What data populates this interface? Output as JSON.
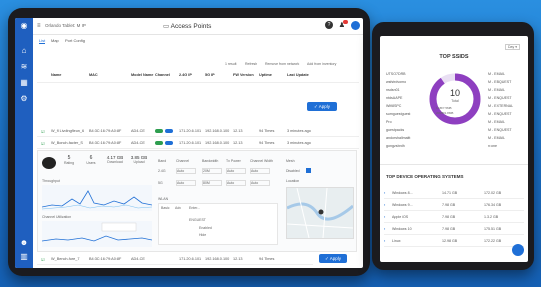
{
  "left": {
    "breadcrumb": "Orlando Tablet: M IP",
    "page_title": "Access Points",
    "tabs": [
      "List",
      "Map",
      "Port Config"
    ],
    "toolbar_actions": [
      "1 result",
      "Refresh",
      "Remove from network",
      "Add from inventory"
    ],
    "columns": [
      "Name",
      "MAC",
      "Model Name",
      "Channel",
      "2.4G IP",
      "5G IP",
      "FW Version",
      "Uptime",
      "Last Update"
    ],
    "apply_label": "Apply",
    "rows": [
      {
        "name": "W_fl Livdingfleun_6",
        "mac": "B4:3C:16:79:A0:8F",
        "model": "AD4-CE",
        "ip24": "171.20.6.101",
        "ip5": "192.168.0.100",
        "fw": "12.13",
        "uptime": "94 Times",
        "updated": "3 minutes ago"
      },
      {
        "name": "W_Bonch-facter_S",
        "mac": "B4:3C:16:79:A0:8F",
        "model": "AD4-CE",
        "ip24": "171.20.6.101",
        "ip5": "192.168.0.100",
        "fw": "12.13",
        "uptime": "94 Times",
        "updated": "3 minutes ago"
      },
      {
        "name": "W_Bench-fure_7",
        "mac": "B4:3C:16:79:A0:8F",
        "model": "AD4-CE",
        "ip24": "171.20.6.101",
        "ip5": "192.168.0.100",
        "fw": "12.13",
        "uptime": "94 Times",
        "updated": "3 minutes ago"
      }
    ],
    "detail": {
      "stats": [
        {
          "v": "5",
          "l": "Rating"
        },
        {
          "v": "6",
          "l": "Users"
        },
        {
          "v": "4.17 GB",
          "l": "Download"
        },
        {
          "v": "3.85 GB",
          "l": "Upload"
        }
      ],
      "throughput_label": "Throughput",
      "channel_util_label": "Channel Utilization",
      "radio_cols": [
        "Band",
        "Channel",
        "Bandwidth",
        "Tx Power",
        "Channel Width"
      ],
      "radio_rows": [
        {
          "band": "2.4G",
          "ch": "Auto",
          "bw": "20M",
          "pw": "Auto",
          "cw": "Auto"
        },
        {
          "band": "5G",
          "ch": "Auto",
          "bw": "80M",
          "pw": "Auto",
          "cw": "Auto"
        }
      ],
      "mesh_label": "Mesh",
      "mesh_value": "Disabled",
      "location_label": "Location",
      "wlan_label": "WLAN",
      "wlan_tabs": [
        "Basic",
        "Adv",
        "Enter..."
      ],
      "wlan_ssid": "ENGUEST",
      "wlan_opts": [
        "Enabled",
        "Hide"
      ]
    }
  },
  "right": {
    "top_ssids_title": "TOP SSIDS",
    "filter": "Day",
    "donut_value": "10",
    "donut_label": "Total",
    "donut_legend": [
      "1GB/7.5MB",
      "20MB/1.8MB"
    ],
    "ssids_left": [
      "UTSO7DRB",
      "wsfstrdvomo",
      "nsdsn01",
      "ntdsAAPE",
      "Wifi8SPC",
      "sumguestguest",
      "Pro",
      "guestpacks",
      "andorshallmaitt",
      "gongzsbrdh"
    ],
    "ssids_right": [
      "M - EMAIL",
      "M - EBQUEST",
      "M - EMAIL",
      "M - ENQUEST",
      "M - EXTERNAL",
      "M - ENQUEST",
      "M - EMAIL",
      "M - ENQUEST",
      "M - EMAIL",
      "n:one"
    ],
    "os_title": "TOP DEVICE OPERATING SYSTEMS",
    "os_rows": [
      {
        "name": "Windows 8...",
        "up": "14.71 GB",
        "down": "172.02 GB"
      },
      {
        "name": "Windows 9...",
        "up": "7.98 GB",
        "down": "176.34 GB"
      },
      {
        "name": "Apple iOS",
        "up": "7.98 GB",
        "down": "1.3.2 GB"
      },
      {
        "name": "Windows 10",
        "up": "7.98 GB",
        "down": "175.51 GB"
      },
      {
        "name": "Linux",
        "up": "12.98 GB",
        "down": "172.22 GB"
      }
    ],
    "colors": {
      "accent": "#7a2ea8",
      "ring": "#8e3fc0",
      "ssid_dot": "#c0187e",
      "os_dot": "#1f6fd6"
    }
  }
}
